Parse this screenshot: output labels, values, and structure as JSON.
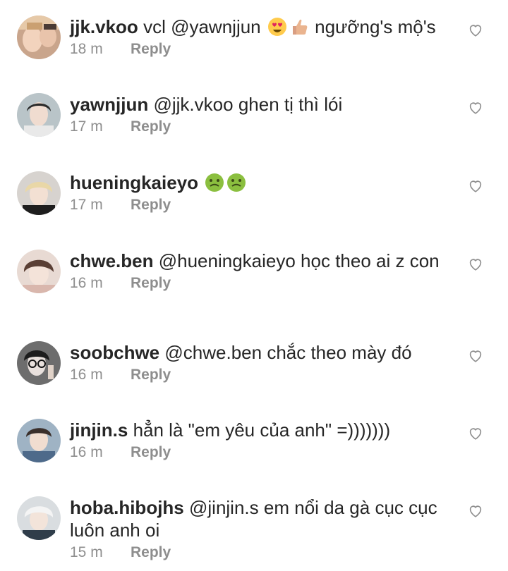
{
  "comments": [
    {
      "username": "jjk.vkoo",
      "text_before": "vcl",
      "mention": "@yawnjjun",
      "emojis": [
        "heart-eyes-emoji",
        "thumbs-up-emoji"
      ],
      "text_after": "ngưỡng's mộ's",
      "time": "18 m",
      "reply_label": "Reply",
      "avatar": "avatar-jjk-vkoo"
    },
    {
      "username": "yawnjjun",
      "text_before": "",
      "mention": "@jjk.vkoo",
      "emojis": [],
      "text_after": "ghen tị thì lói",
      "time": "17 m",
      "reply_label": "Reply",
      "avatar": "avatar-yawnjjun"
    },
    {
      "username": "hueningkaieyo",
      "text_before": "",
      "mention": "",
      "emojis": [
        "nauseated-face-emoji",
        "nauseated-face-emoji"
      ],
      "text_after": "",
      "time": "17 m",
      "reply_label": "Reply",
      "avatar": "avatar-hueningkaieyo"
    },
    {
      "username": "chwe.ben",
      "text_before": "",
      "mention": "@hueningkaieyo",
      "emojis": [],
      "text_after": "học theo ai z con",
      "time": "16 m",
      "reply_label": "Reply",
      "avatar": "avatar-chwe-ben"
    },
    {
      "username": "soobchwe",
      "text_before": "",
      "mention": "@chwe.ben",
      "emojis": [],
      "text_after": "chắc theo mày đó",
      "time": "16 m",
      "reply_label": "Reply",
      "avatar": "avatar-soobchwe"
    },
    {
      "username": "jinjin.s",
      "text_before": "hẳn là \"em yêu của anh\" =)))))))",
      "mention": "",
      "emojis": [],
      "text_after": "",
      "time": "16 m",
      "reply_label": "Reply",
      "avatar": "avatar-jinjin-s"
    },
    {
      "username": "hoba.hibojhs",
      "text_before": "",
      "mention": "@jinjin.s",
      "emojis": [],
      "text_after": "em nổi da gà cục cục luôn anh oi",
      "time": "15 m",
      "reply_label": "Reply",
      "avatar": "avatar-hoba-hibojhs"
    }
  ],
  "colors": {
    "text": "#262626",
    "meta": "#8e8e8e",
    "background": "#ffffff"
  }
}
